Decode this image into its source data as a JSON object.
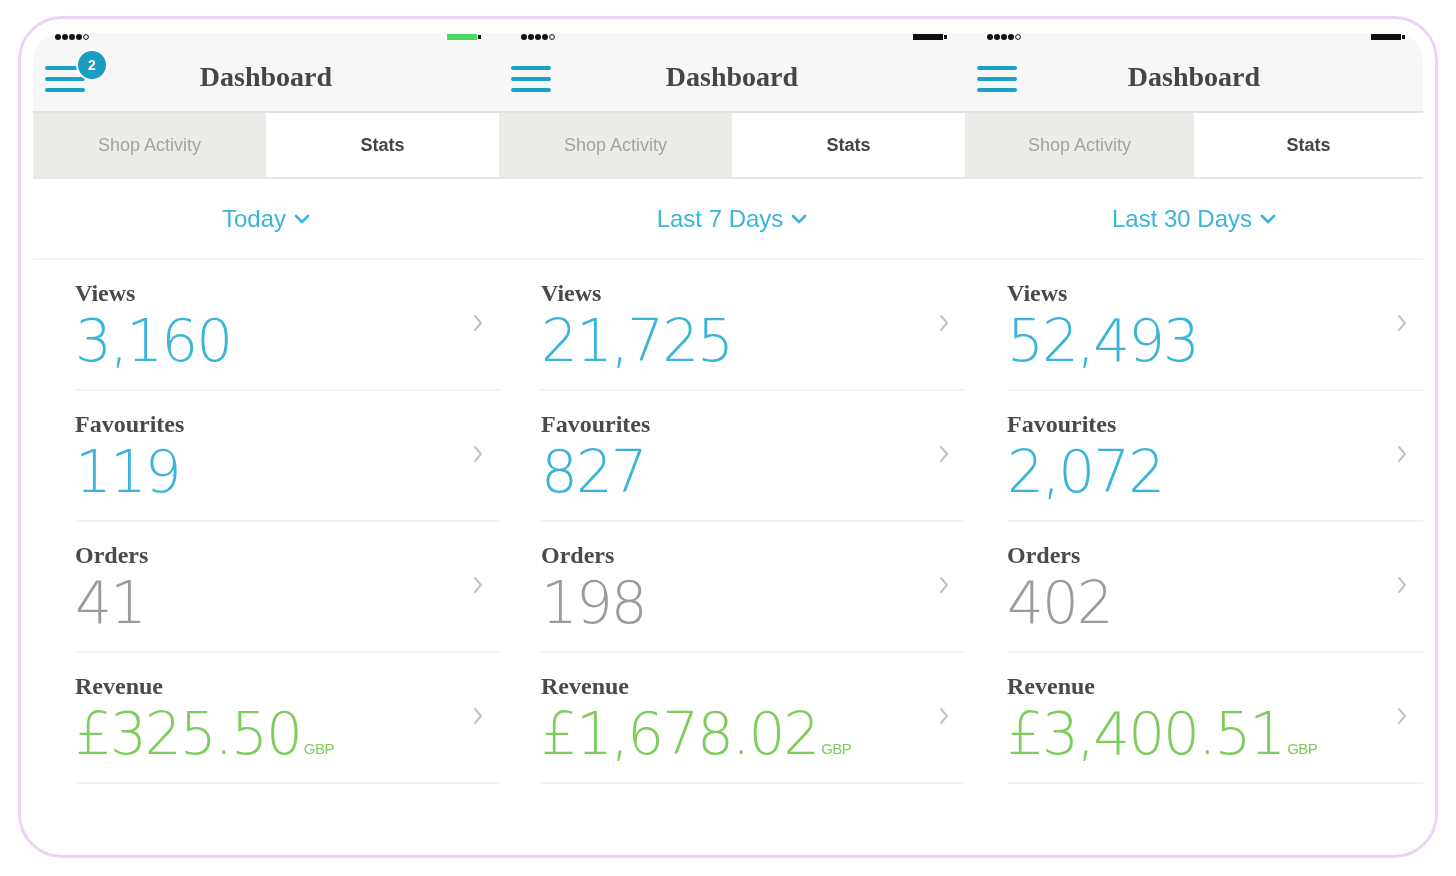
{
  "screens": [
    {
      "status_bar": {
        "battery_charging": true
      },
      "nav_bar": {
        "title": "Dashboard",
        "menu_badge": "2"
      },
      "tabs": [
        {
          "label": "Shop Activity",
          "selected": false
        },
        {
          "label": "Stats",
          "selected": true
        }
      ],
      "period_dropdown": {
        "value": "Today"
      },
      "stats": [
        {
          "label": "Views",
          "value": "3,160",
          "color": "#3ab4d8"
        },
        {
          "label": "Favourites",
          "value": "119",
          "color": "#3ab4d8"
        },
        {
          "label": "Orders",
          "value": "41",
          "color": "#9b9b9b"
        },
        {
          "label": "Revenue",
          "value": "£325.50",
          "unit": "GBP",
          "color": "#7ccd5c"
        }
      ]
    },
    {
      "status_bar": {
        "battery_charging": false
      },
      "nav_bar": {
        "title": "Dashboard"
      },
      "tabs": [
        {
          "label": "Shop Activity",
          "selected": false
        },
        {
          "label": "Stats",
          "selected": true
        }
      ],
      "period_dropdown": {
        "value": "Last 7 Days"
      },
      "stats": [
        {
          "label": "Views",
          "value": "21,725",
          "color": "#3ab4d8"
        },
        {
          "label": "Favourites",
          "value": "827",
          "color": "#3ab4d8"
        },
        {
          "label": "Orders",
          "value": "198",
          "color": "#9b9b9b"
        },
        {
          "label": "Revenue",
          "value": "£1,678.02",
          "unit": "GBP",
          "color": "#7ccd5c"
        }
      ]
    },
    {
      "status_bar": {
        "battery_charging": false
      },
      "nav_bar": {
        "title": "Dashboard"
      },
      "tabs": [
        {
          "label": "Shop Activity",
          "selected": false
        },
        {
          "label": "Stats",
          "selected": true
        }
      ],
      "period_dropdown": {
        "value": "Last 30 Days"
      },
      "stats": [
        {
          "label": "Views",
          "value": "52,493",
          "color": "#3ab4d8"
        },
        {
          "label": "Favourites",
          "value": "2,072",
          "color": "#3ab4d8"
        },
        {
          "label": "Orders",
          "value": "402",
          "color": "#9b9b9b"
        },
        {
          "label": "Revenue",
          "value": "£3,400.51",
          "unit": "GBP",
          "color": "#7ccd5c"
        }
      ]
    }
  ]
}
